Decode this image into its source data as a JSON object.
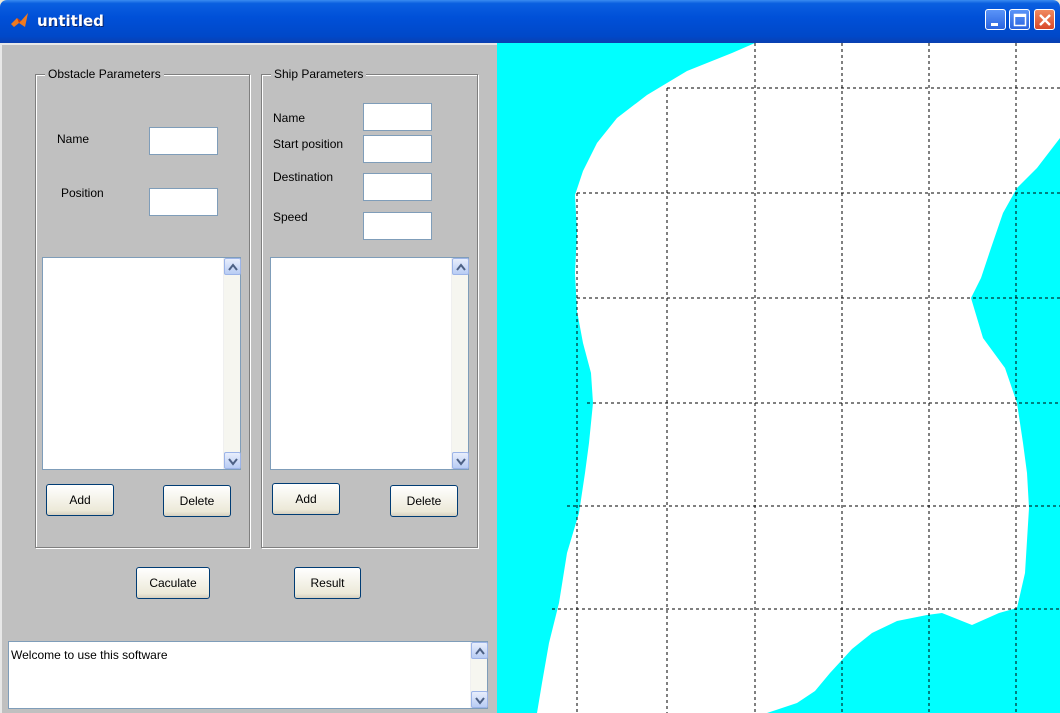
{
  "window": {
    "title": "untitled",
    "minimize_icon": "minimize-icon",
    "maximize_icon": "maximize-icon",
    "close_icon": "close-icon"
  },
  "obstacle": {
    "legend": "Obstacle Parameters",
    "name_label": "Name",
    "name_value": "",
    "position_label": "Position",
    "position_value": "",
    "list_items": [],
    "add_label": "Add",
    "delete_label": "Delete"
  },
  "ship": {
    "legend": "Ship Parameters",
    "name_label": "Name",
    "name_value": "",
    "start_label": "Start position",
    "start_value": "",
    "destination_label": "Destination",
    "destination_value": "",
    "speed_label": "Speed",
    "speed_value": "",
    "list_items": [],
    "add_label": "Add",
    "delete_label": "Delete"
  },
  "actions": {
    "calculate_label": "Caculate",
    "result_label": "Result"
  },
  "console": {
    "message": "Welcome to use this software"
  },
  "map": {
    "water_color": "#00ffff",
    "grid": "dashed",
    "background": "#ffffff"
  }
}
